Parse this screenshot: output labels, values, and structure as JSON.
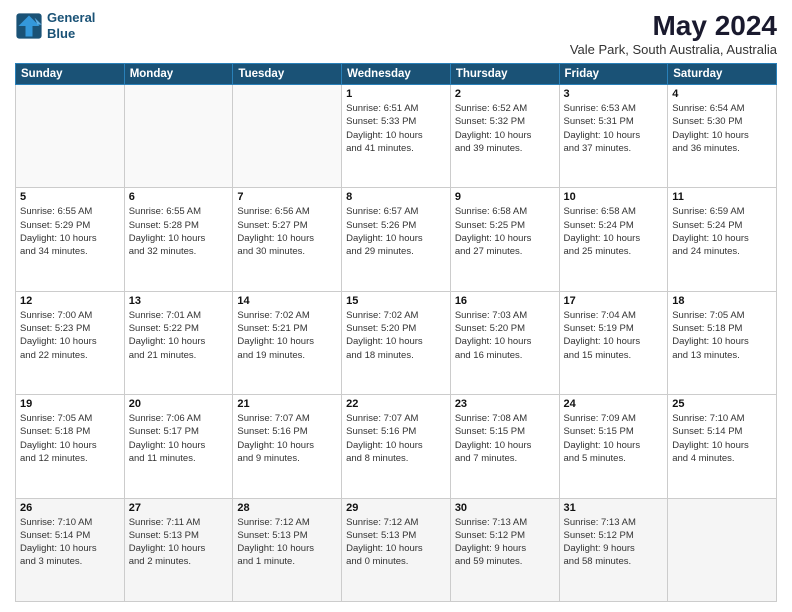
{
  "header": {
    "logo_line1": "General",
    "logo_line2": "Blue",
    "main_title": "May 2024",
    "subtitle": "Vale Park, South Australia, Australia"
  },
  "days_of_week": [
    "Sunday",
    "Monday",
    "Tuesday",
    "Wednesday",
    "Thursday",
    "Friday",
    "Saturday"
  ],
  "weeks": [
    [
      {
        "day": "",
        "info": ""
      },
      {
        "day": "",
        "info": ""
      },
      {
        "day": "",
        "info": ""
      },
      {
        "day": "1",
        "info": "Sunrise: 6:51 AM\nSunset: 5:33 PM\nDaylight: 10 hours\nand 41 minutes."
      },
      {
        "day": "2",
        "info": "Sunrise: 6:52 AM\nSunset: 5:32 PM\nDaylight: 10 hours\nand 39 minutes."
      },
      {
        "day": "3",
        "info": "Sunrise: 6:53 AM\nSunset: 5:31 PM\nDaylight: 10 hours\nand 37 minutes."
      },
      {
        "day": "4",
        "info": "Sunrise: 6:54 AM\nSunset: 5:30 PM\nDaylight: 10 hours\nand 36 minutes."
      }
    ],
    [
      {
        "day": "5",
        "info": "Sunrise: 6:55 AM\nSunset: 5:29 PM\nDaylight: 10 hours\nand 34 minutes."
      },
      {
        "day": "6",
        "info": "Sunrise: 6:55 AM\nSunset: 5:28 PM\nDaylight: 10 hours\nand 32 minutes."
      },
      {
        "day": "7",
        "info": "Sunrise: 6:56 AM\nSunset: 5:27 PM\nDaylight: 10 hours\nand 30 minutes."
      },
      {
        "day": "8",
        "info": "Sunrise: 6:57 AM\nSunset: 5:26 PM\nDaylight: 10 hours\nand 29 minutes."
      },
      {
        "day": "9",
        "info": "Sunrise: 6:58 AM\nSunset: 5:25 PM\nDaylight: 10 hours\nand 27 minutes."
      },
      {
        "day": "10",
        "info": "Sunrise: 6:58 AM\nSunset: 5:24 PM\nDaylight: 10 hours\nand 25 minutes."
      },
      {
        "day": "11",
        "info": "Sunrise: 6:59 AM\nSunset: 5:24 PM\nDaylight: 10 hours\nand 24 minutes."
      }
    ],
    [
      {
        "day": "12",
        "info": "Sunrise: 7:00 AM\nSunset: 5:23 PM\nDaylight: 10 hours\nand 22 minutes."
      },
      {
        "day": "13",
        "info": "Sunrise: 7:01 AM\nSunset: 5:22 PM\nDaylight: 10 hours\nand 21 minutes."
      },
      {
        "day": "14",
        "info": "Sunrise: 7:02 AM\nSunset: 5:21 PM\nDaylight: 10 hours\nand 19 minutes."
      },
      {
        "day": "15",
        "info": "Sunrise: 7:02 AM\nSunset: 5:20 PM\nDaylight: 10 hours\nand 18 minutes."
      },
      {
        "day": "16",
        "info": "Sunrise: 7:03 AM\nSunset: 5:20 PM\nDaylight: 10 hours\nand 16 minutes."
      },
      {
        "day": "17",
        "info": "Sunrise: 7:04 AM\nSunset: 5:19 PM\nDaylight: 10 hours\nand 15 minutes."
      },
      {
        "day": "18",
        "info": "Sunrise: 7:05 AM\nSunset: 5:18 PM\nDaylight: 10 hours\nand 13 minutes."
      }
    ],
    [
      {
        "day": "19",
        "info": "Sunrise: 7:05 AM\nSunset: 5:18 PM\nDaylight: 10 hours\nand 12 minutes."
      },
      {
        "day": "20",
        "info": "Sunrise: 7:06 AM\nSunset: 5:17 PM\nDaylight: 10 hours\nand 11 minutes."
      },
      {
        "day": "21",
        "info": "Sunrise: 7:07 AM\nSunset: 5:16 PM\nDaylight: 10 hours\nand 9 minutes."
      },
      {
        "day": "22",
        "info": "Sunrise: 7:07 AM\nSunset: 5:16 PM\nDaylight: 10 hours\nand 8 minutes."
      },
      {
        "day": "23",
        "info": "Sunrise: 7:08 AM\nSunset: 5:15 PM\nDaylight: 10 hours\nand 7 minutes."
      },
      {
        "day": "24",
        "info": "Sunrise: 7:09 AM\nSunset: 5:15 PM\nDaylight: 10 hours\nand 5 minutes."
      },
      {
        "day": "25",
        "info": "Sunrise: 7:10 AM\nSunset: 5:14 PM\nDaylight: 10 hours\nand 4 minutes."
      }
    ],
    [
      {
        "day": "26",
        "info": "Sunrise: 7:10 AM\nSunset: 5:14 PM\nDaylight: 10 hours\nand 3 minutes."
      },
      {
        "day": "27",
        "info": "Sunrise: 7:11 AM\nSunset: 5:13 PM\nDaylight: 10 hours\nand 2 minutes."
      },
      {
        "day": "28",
        "info": "Sunrise: 7:12 AM\nSunset: 5:13 PM\nDaylight: 10 hours\nand 1 minute."
      },
      {
        "day": "29",
        "info": "Sunrise: 7:12 AM\nSunset: 5:13 PM\nDaylight: 10 hours\nand 0 minutes."
      },
      {
        "day": "30",
        "info": "Sunrise: 7:13 AM\nSunset: 5:12 PM\nDaylight: 9 hours\nand 59 minutes."
      },
      {
        "day": "31",
        "info": "Sunrise: 7:13 AM\nSunset: 5:12 PM\nDaylight: 9 hours\nand 58 minutes."
      },
      {
        "day": "",
        "info": ""
      }
    ]
  ]
}
